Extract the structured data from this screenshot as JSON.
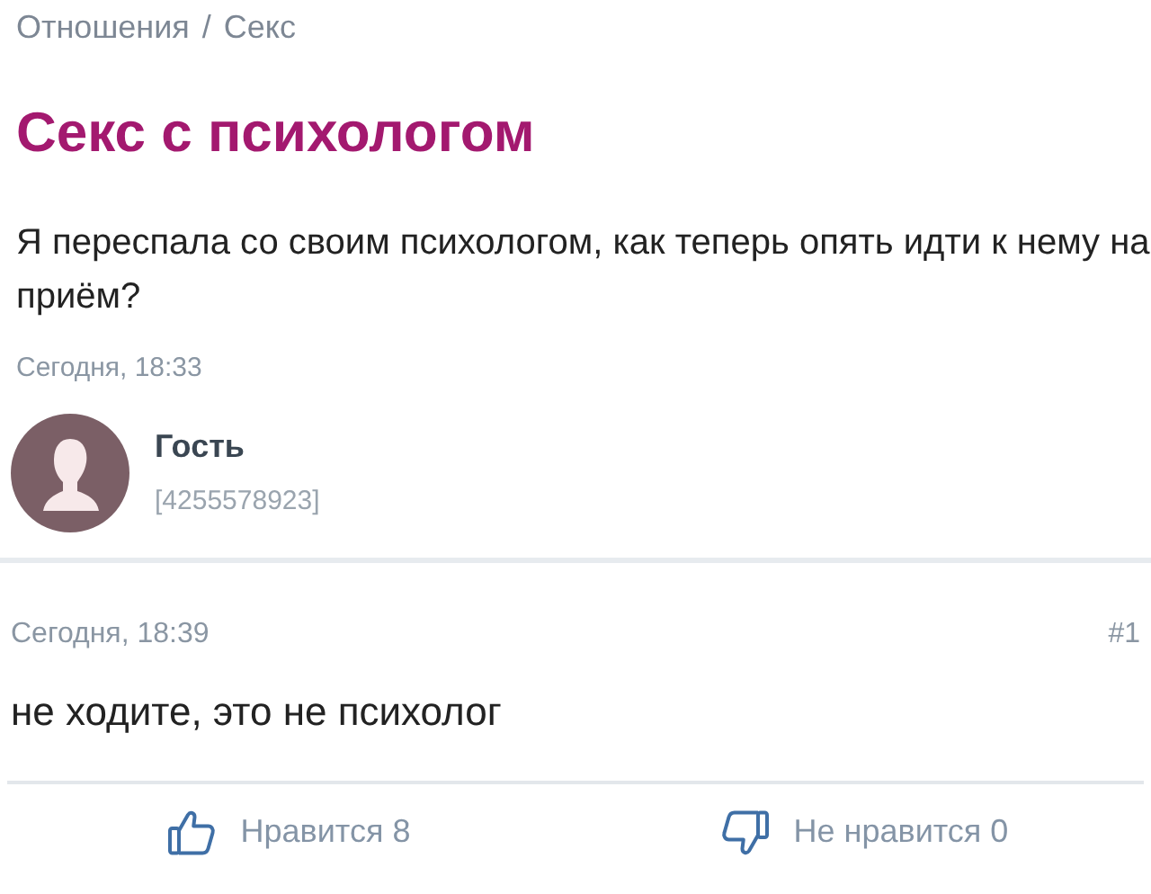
{
  "breadcrumbs": {
    "items": [
      "Отношения",
      "Секс"
    ],
    "separator": "/"
  },
  "topic": {
    "title": "Секс с психологом",
    "text": "Я переспала со своим психологом, как теперь опять идти к нему на приём?",
    "date": "Сегодня, 18:33",
    "author": {
      "name": "Гость",
      "id": "[4255578923]"
    }
  },
  "reply": {
    "date": "Сегодня, 18:39",
    "number": "#1",
    "text": "не ходите, это не психолог"
  },
  "votes": [
    {
      "kind": "like",
      "label": "Нравится 8"
    },
    {
      "kind": "dislike",
      "label": "Не нравится 0"
    }
  ]
}
